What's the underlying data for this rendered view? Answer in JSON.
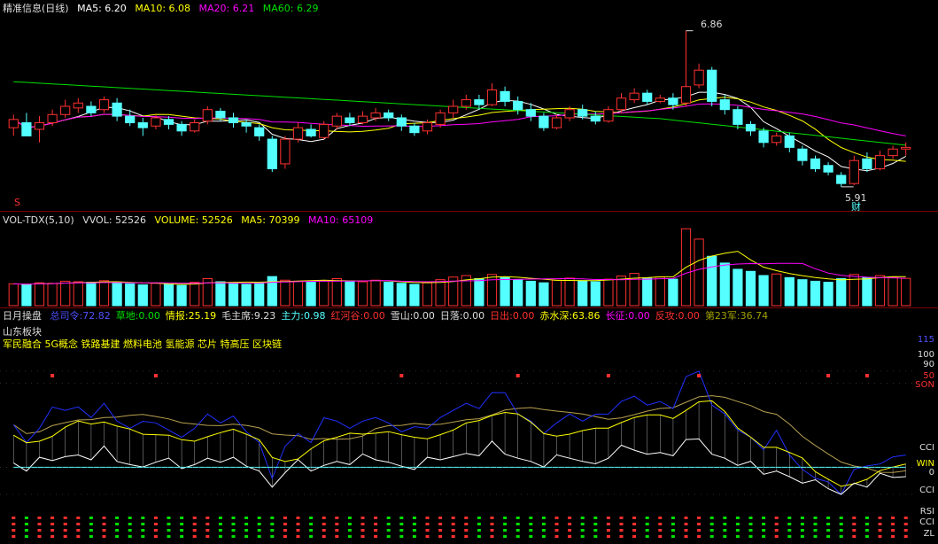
{
  "colors": {
    "red": "#ff3030",
    "cyan": "#54ffff",
    "white": "#ffffff",
    "yellow": "#ffff00",
    "magenta": "#ff00ff",
    "green": "#00e000",
    "bg": "#000000",
    "grid": "#7a0000"
  },
  "kline": {
    "title": "精准信息(日线)",
    "ma5": "MA5: 6.20",
    "ma10": "MA10: 6.08",
    "ma20": "MA20: 6.21",
    "ma60": "MA60: 6.29",
    "high_label": "6.86",
    "low_label": "5.91",
    "marker_s": "S",
    "marker_cai": "财"
  },
  "volume": {
    "title": "VOL-TDX(5,10)",
    "vvol": "VVOL: 52526",
    "volume": "VOLUME: 52526",
    "ma5": "MA5: 70399",
    "ma10": "MA10: 65109"
  },
  "indicator": {
    "title": "日月操盘",
    "items": [
      {
        "label": "总司令:",
        "value": "72.82"
      },
      {
        "label": "草地:",
        "value": "0.00"
      },
      {
        "label": "情报:",
        "value": "25.19"
      },
      {
        "label": "毛主席:",
        "value": "9.23"
      },
      {
        "label": "主力:",
        "value": "0.98"
      },
      {
        "label": "红河谷:",
        "value": "0.00"
      },
      {
        "label": "雪山:",
        "value": "0.00"
      },
      {
        "label": "日落:",
        "value": "0.00"
      },
      {
        "label": "日出:",
        "value": "0.00"
      },
      {
        "label": "赤水深:",
        "value": "63.86"
      },
      {
        "label": "长征:",
        "value": "0.00"
      },
      {
        "label": "反攻:",
        "value": "0.00"
      },
      {
        "label": "第23军:",
        "value": "36.74"
      }
    ],
    "region": "山东板块",
    "concepts": "军民融合 5G概念 铁路基建 燃料电池 氢能源 芯片 特高压 区块链",
    "right_labels": [
      "115",
      "100",
      "90",
      "50",
      "SON",
      "CCI",
      "WIN",
      "0",
      "CCI",
      "RSI",
      "CCI",
      "ZL"
    ]
  },
  "candles": [
    [
      6.27,
      6.32,
      6.22,
      6.35,
      6.18
    ],
    [
      6.3,
      6.22,
      6.24,
      6.36,
      6.18
    ],
    [
      6.26,
      6.3,
      6.18,
      6.34,
      6.15
    ],
    [
      6.3,
      6.35,
      6.28,
      6.38,
      6.25
    ],
    [
      6.35,
      6.4,
      6.33,
      6.44,
      6.3
    ],
    [
      6.39,
      6.42,
      6.36,
      6.45,
      6.33
    ],
    [
      6.4,
      6.36,
      6.34,
      6.43,
      6.32
    ],
    [
      6.38,
      6.44,
      6.36,
      6.46,
      6.33
    ],
    [
      6.42,
      6.34,
      6.31,
      6.45,
      6.3
    ],
    [
      6.34,
      6.3,
      6.28,
      6.38,
      6.25
    ],
    [
      6.3,
      6.27,
      6.22,
      6.33,
      6.2
    ],
    [
      6.28,
      6.33,
      6.26,
      6.35,
      6.24
    ],
    [
      6.32,
      6.29,
      6.26,
      6.34,
      6.23
    ],
    [
      6.29,
      6.25,
      6.22,
      6.31,
      6.2
    ],
    [
      6.25,
      6.3,
      6.24,
      6.32,
      6.22
    ],
    [
      6.31,
      6.38,
      6.29,
      6.4,
      6.27
    ],
    [
      6.37,
      6.33,
      6.31,
      6.39,
      6.3
    ],
    [
      6.33,
      6.3,
      6.27,
      6.36,
      6.25
    ],
    [
      6.3,
      6.28,
      6.24,
      6.32,
      6.22
    ],
    [
      6.27,
      6.22,
      6.19,
      6.29,
      6.17
    ],
    [
      6.2,
      6.02,
      6.0,
      6.22,
      5.98
    ],
    [
      6.05,
      6.2,
      6.02,
      6.22,
      6.0
    ],
    [
      6.2,
      6.27,
      6.18,
      6.3,
      6.16
    ],
    [
      6.26,
      6.22,
      6.21,
      6.29,
      6.19
    ],
    [
      6.21,
      6.29,
      6.2,
      6.31,
      6.18
    ],
    [
      6.28,
      6.34,
      6.26,
      6.36,
      6.25
    ],
    [
      6.33,
      6.3,
      6.28,
      6.36,
      6.27
    ],
    [
      6.3,
      6.34,
      6.29,
      6.37,
      6.28
    ],
    [
      6.33,
      6.36,
      6.31,
      6.39,
      6.3
    ],
    [
      6.36,
      6.33,
      6.31,
      6.38,
      6.3
    ],
    [
      6.33,
      6.28,
      6.25,
      6.35,
      6.23
    ],
    [
      6.28,
      6.24,
      6.22,
      6.3,
      6.2
    ],
    [
      6.25,
      6.3,
      6.23,
      6.32,
      6.21
    ],
    [
      6.29,
      6.36,
      6.27,
      6.38,
      6.26
    ],
    [
      6.36,
      6.4,
      6.33,
      6.44,
      6.31
    ],
    [
      6.4,
      6.44,
      6.38,
      6.47,
      6.36
    ],
    [
      6.44,
      6.41,
      6.38,
      6.47,
      6.37
    ],
    [
      6.41,
      6.5,
      6.4,
      6.54,
      6.38
    ],
    [
      6.49,
      6.43,
      6.4,
      6.52,
      6.38
    ],
    [
      6.43,
      6.38,
      6.35,
      6.46,
      6.33
    ],
    [
      6.38,
      6.34,
      6.31,
      6.42,
      6.3
    ],
    [
      6.34,
      6.27,
      6.25,
      6.36,
      6.24
    ],
    [
      6.27,
      6.33,
      6.26,
      6.35,
      6.25
    ],
    [
      6.33,
      6.38,
      6.31,
      6.4,
      6.3
    ],
    [
      6.38,
      6.34,
      6.32,
      6.41,
      6.3
    ],
    [
      6.34,
      6.31,
      6.29,
      6.37,
      6.27
    ],
    [
      6.31,
      6.38,
      6.3,
      6.4,
      6.28
    ],
    [
      6.38,
      6.45,
      6.36,
      6.48,
      6.35
    ],
    [
      6.44,
      6.48,
      6.42,
      6.51,
      6.4
    ],
    [
      6.48,
      6.43,
      6.41,
      6.5,
      6.39
    ],
    [
      6.43,
      6.45,
      6.42,
      6.47,
      6.4
    ],
    [
      6.45,
      6.41,
      6.38,
      6.48,
      6.37
    ],
    [
      6.42,
      6.52,
      6.4,
      6.86,
      6.39
    ],
    [
      6.53,
      6.62,
      6.51,
      6.66,
      6.5
    ],
    [
      6.62,
      6.43,
      6.4,
      6.64,
      6.38
    ],
    [
      6.44,
      6.38,
      6.35,
      6.47,
      6.34
    ],
    [
      6.38,
      6.29,
      6.26,
      6.4,
      6.24
    ],
    [
      6.29,
      6.25,
      6.22,
      6.31,
      6.2
    ],
    [
      6.25,
      6.18,
      6.15,
      6.27,
      6.13
    ],
    [
      6.18,
      6.22,
      6.16,
      6.24,
      6.14
    ],
    [
      6.22,
      6.15,
      6.12,
      6.24,
      6.1
    ],
    [
      6.14,
      6.07,
      6.04,
      6.16,
      6.02
    ],
    [
      6.08,
      6.02,
      6.0,
      6.1,
      5.98
    ],
    [
      6.04,
      6.0,
      5.98,
      6.06,
      5.96
    ],
    [
      5.98,
      5.93,
      5.91,
      6.0,
      5.91
    ],
    [
      5.93,
      6.07,
      5.92,
      6.1,
      5.91
    ],
    [
      6.08,
      6.02,
      6.0,
      6.12,
      5.98
    ],
    [
      6.02,
      6.1,
      6.01,
      6.13,
      6.0
    ],
    [
      6.1,
      6.14,
      6.08,
      6.16,
      6.06
    ],
    [
      6.14,
      6.15,
      6.1,
      6.18,
      6.08
    ]
  ],
  "volumes": [
    42000,
    41000,
    44000,
    43000,
    47000,
    46000,
    45000,
    48000,
    44000,
    42000,
    40000,
    43000,
    41000,
    39000,
    45000,
    52000,
    46000,
    43000,
    41000,
    44000,
    56000,
    49000,
    47000,
    45000,
    48000,
    52000,
    47000,
    46000,
    49000,
    45000,
    43000,
    41000,
    44000,
    50000,
    55000,
    58000,
    52000,
    60000,
    54000,
    50000,
    47000,
    44000,
    49000,
    53000,
    48000,
    46000,
    51000,
    57000,
    62000,
    53000,
    55000,
    51000,
    148000,
    128000,
    95000,
    82000,
    70000,
    66000,
    58000,
    61000,
    54000,
    50000,
    47000,
    45000,
    52000,
    60000,
    54000,
    58000,
    55000,
    52526
  ]
}
